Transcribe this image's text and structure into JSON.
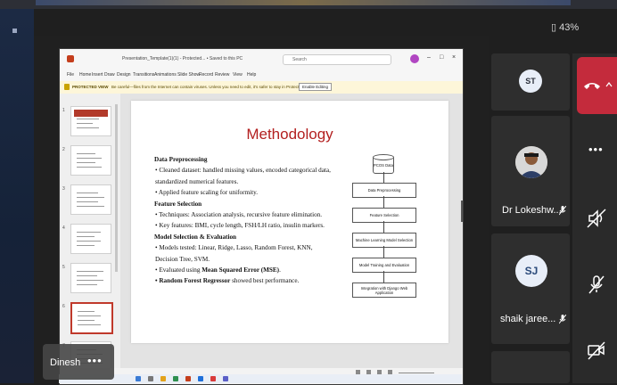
{
  "status": {
    "battery": "43%"
  },
  "ppt": {
    "title": "Presentation_Template(1)(1) - Protected... • Saved to this PC",
    "search": "Search",
    "menu": [
      "File",
      "Home",
      "Insert",
      "Draw",
      "Design",
      "Transitions",
      "Animations",
      "Slide Show",
      "Record",
      "Review",
      "View",
      "Help"
    ],
    "protected": {
      "label": "PROTECTED VIEW",
      "message": "Be careful—files from the Internet can contain viruses. Unless you need to edit, it's safer to stay in Protected View.",
      "button": "Enable Editing"
    },
    "thumb_numbers": [
      "1",
      "2",
      "3",
      "4",
      "5",
      "6",
      "7"
    ],
    "slide": {
      "title": "Methodology",
      "lines": [
        {
          "type": "h",
          "text": "Data Preprocessing"
        },
        {
          "type": "b",
          "text": "• Cleaned dataset: handled missing values, encoded categorical data, standardized numerical features."
        },
        {
          "type": "b",
          "text": "• Applied feature scaling for uniformity."
        },
        {
          "type": "h",
          "text": "Feature Selection"
        },
        {
          "type": "b",
          "text": "• Techniques: Association analysis, recursive feature elimination."
        },
        {
          "type": "b",
          "text": "• Key features: BMI, cycle length, FSH/LH ratio, insulin markers."
        },
        {
          "type": "h",
          "text": "Model Selection & Evaluation"
        },
        {
          "type": "b",
          "text": "• Models tested: Linear, Ridge, Lasso, Random Forest, KNN, Decision Tree, SVM."
        }
      ],
      "mse_prefix": "• Evaluated using ",
      "mse_bold": "Mean Squared Error (MSE)",
      "mse_suffix": ".",
      "rf_bold": "Random Forest Regressor",
      "rf_suffix": " showed best performance.",
      "flow": [
        "PCOS Data",
        "Data Preprocessing",
        "Feature Selection",
        "Machine Learning Model Selection",
        "Model Training and Evaluation",
        "Integration with Django Web Application"
      ]
    }
  },
  "participants": [
    {
      "initials": "ST",
      "name": ""
    },
    {
      "initials": "",
      "name": "Dr Lokeshw..."
    },
    {
      "initials": "SJ",
      "name": "shaik jaree..."
    }
  ],
  "presenter": {
    "name": "Dinesh",
    "more": "•••"
  },
  "controls": {
    "more": "•••"
  }
}
